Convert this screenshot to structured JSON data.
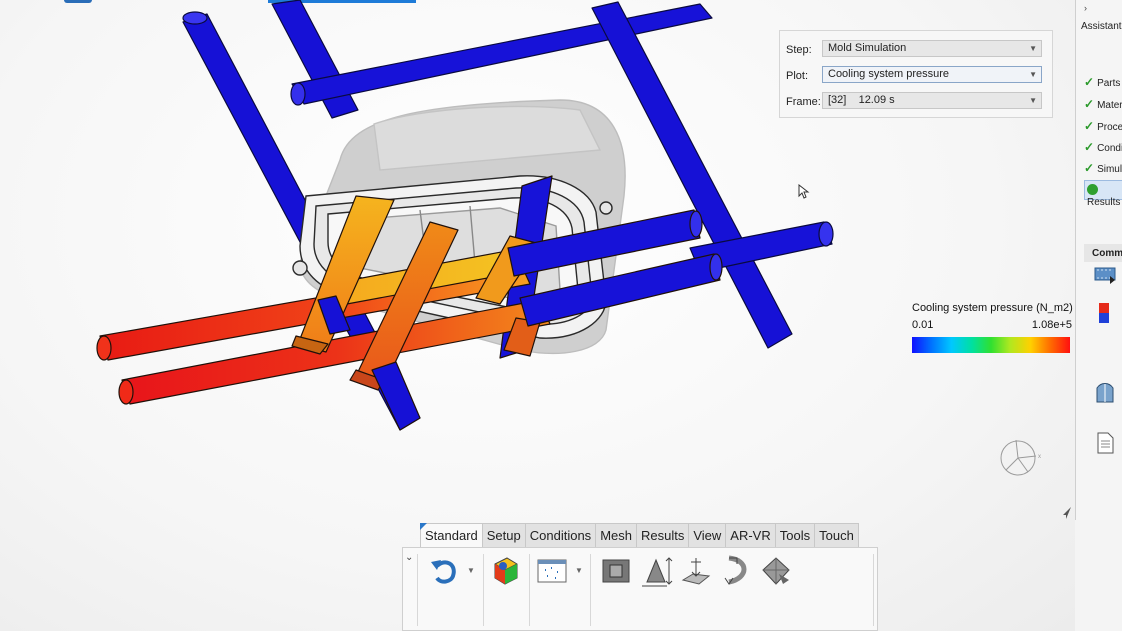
{
  "plot_panel": {
    "step_label": "Step:",
    "step_value": "Mold Simulation",
    "plot_label": "Plot:",
    "plot_value": "Cooling system pressure",
    "frame_label": "Frame:",
    "frame_value": "[32]    12.09 s"
  },
  "legend": {
    "title": "Cooling system pressure (N_m2)",
    "min": "0.01",
    "max": "1.08e+5"
  },
  "assistant": {
    "collapse_glyph": "›",
    "title": "Assistant",
    "items": [
      {
        "label": "Parts",
        "status": "done"
      },
      {
        "label": "Materials",
        "status": "done"
      },
      {
        "label": "Process",
        "status": "done"
      },
      {
        "label": "Conditions",
        "status": "done"
      },
      {
        "label": "Simulation",
        "status": "done"
      },
      {
        "label": "Results",
        "status": "current"
      }
    ],
    "commands_label": "Commands",
    "tool_icons": [
      "animation-icon",
      "color-bar-icon",
      "section-cut-icon",
      "report-icon"
    ]
  },
  "ribbon": {
    "tabs": [
      "Standard",
      "Setup",
      "Conditions",
      "Mesh",
      "Results",
      "View",
      "AR-VR",
      "Tools",
      "Touch"
    ],
    "active_tab": "Standard",
    "collapse_glyph": "⌄",
    "buttons": [
      "undo-icon",
      "material-library-icon",
      "mesh-display-icon",
      "part-icon",
      "measure-icon",
      "section-plane-icon",
      "deform-icon",
      "view-cube-icon"
    ]
  },
  "colors": {
    "cold_channel": "#1412d8",
    "hot_channel": "#f02a1a",
    "accent": "#1e7bd8"
  }
}
